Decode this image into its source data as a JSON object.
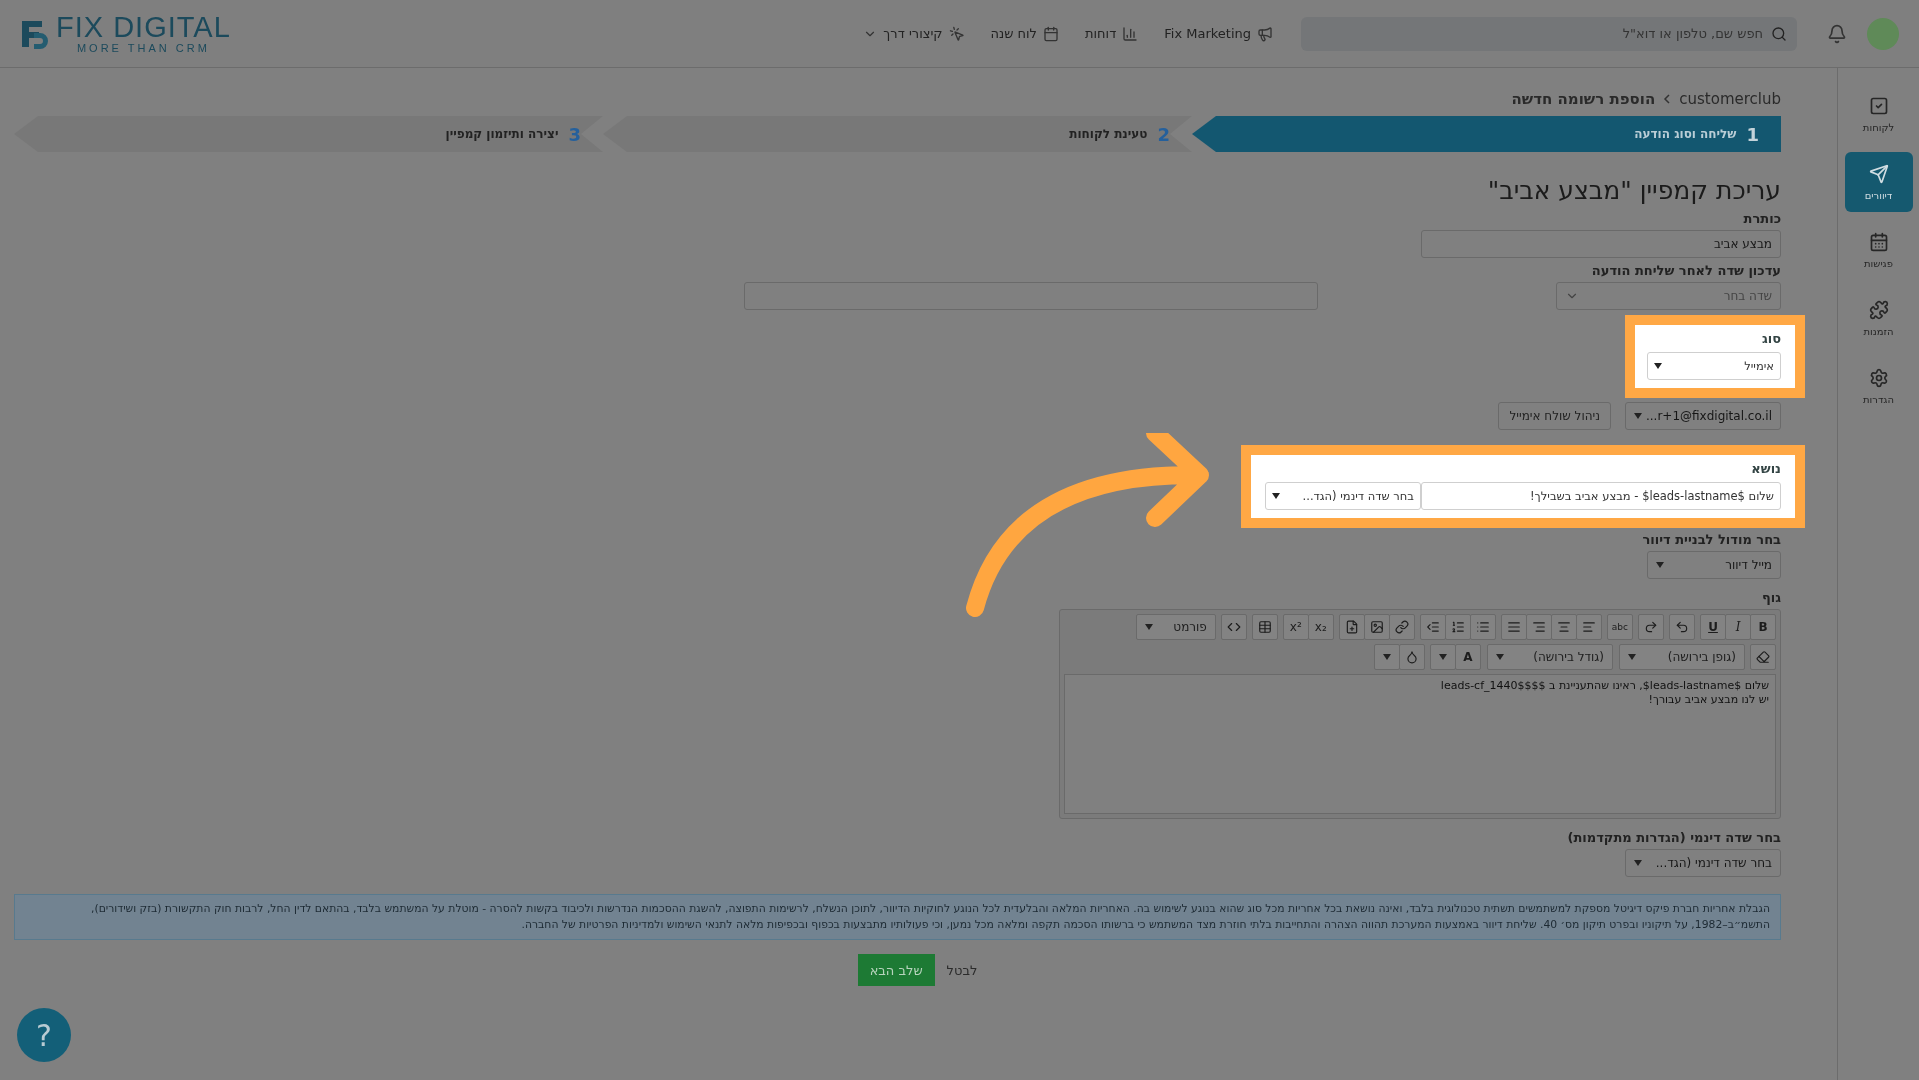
{
  "header": {
    "logo": {
      "name": "FIX DIGITAL",
      "tagline": "MORE THAN CRM"
    },
    "nav": [
      {
        "label": "Fix Marketing"
      },
      {
        "label": "דוחות"
      },
      {
        "label": "לוח שנה"
      },
      {
        "label": "קיצורי דרך"
      }
    ],
    "search": {
      "placeholder": "חפש שם, טלפון או דוא\"ל"
    }
  },
  "sidebar": {
    "items": [
      {
        "label": "לקוחות",
        "selected": false
      },
      {
        "label": "דיוורים",
        "selected": true
      },
      {
        "label": "פגישות",
        "selected": false
      },
      {
        "label": "הזמנות",
        "selected": false
      },
      {
        "label": "הגדרות",
        "selected": false
      }
    ]
  },
  "breadcrumb": [
    "customerclub",
    "הוספת רשומה חדשה"
  ],
  "steps": [
    {
      "number": "1",
      "label": "שליחה וסוג הודעה",
      "selected": true
    },
    {
      "number": "2",
      "label": "טעינת לקוחות",
      "selected": false
    },
    {
      "number": "3",
      "label": "יצירה ותיזמון קמפיין",
      "selected": false
    }
  ],
  "form": {
    "heading": "עריכת קמפיין \"מבצע אביב\"",
    "title": {
      "label": "כותרת",
      "value": "מבצע אביב"
    },
    "update_field": {
      "label": "עדכון שדה לאחר שליחת הודעה",
      "placeholder": "שדה בחר"
    },
    "type": {
      "label": "סוג",
      "value": "אימייל"
    },
    "sender": {
      "value": "...r+1@fixdigital.co.il",
      "manage_button": "ניהול שולח אימייל"
    },
    "subject": {
      "label": "נושא",
      "value": "שלום $leads-lastname$ - מבצע אביב בשבילך!",
      "dynamic": "בחר שדה דינמי (הגד..."
    },
    "module": {
      "label": "בחר מודול לבניית דיוור",
      "value": "מייל דיוור"
    },
    "body": {
      "label": "גוף",
      "toolbar": {
        "bold": "B",
        "italic": "I",
        "underline": "U",
        "spell": "abc",
        "sup": "x²",
        "sub": "x₂",
        "format": "פורמט",
        "font": "(גופן בירושה)",
        "size": "(גודל בירושה)",
        "text_color_label": "A"
      },
      "lines": [
        "שלום $leads-lastname$, ראינו שהתעניינת ב $$leads-cf_1440$$",
        "יש לנו מבצע אביב עבורך!"
      ]
    },
    "dynamic_field": {
      "label": "בחר שדה דינמי (הגדרות מתקדמות)",
      "value": "בחר שדה דינמי (הגד..."
    }
  },
  "disclaimer": "הגבלת אחריות חברת פיקס דיגיטל מספקת למשתמשים תשתית טכנולוגית בלבד, ואינה נושאת בכל אחריות מכל סוג שהוא בנוגע לשימוש בה. האחריות המלאה והבלעדית לכל הנוגע לחוקיות הדיוור, לתוכן הנשלח, לרשימות התפוצה, להשגת ההסכמות הנדרשות ולכיבוד בקשות להסרה - מוטלת על המשתמש בלבד, בהתאם לדין החל, לרבות חוק התקשורת (בזק ושידורים), התשמ״ב–1982, על תיקוניו ובפרט תיקון מס׳ 40. שליחת דיוור באמצעות המערכת תהווה הצהרה והתחייבות בלתי חוזרת מצד המשתמש כי ברשותו הסכמה תקפה ומלאה מכל נמען, וכי פעולותיו מתבצעות בכפוף ובכפיפות מלאה לתנאי השימוש ולמדיניות הפרטיות של החברה.",
  "actions": [
    {
      "label": "לבטל",
      "kind": "link"
    },
    {
      "label": "שלב הבא",
      "kind": "primary"
    }
  ],
  "help": {
    "label": "?"
  }
}
